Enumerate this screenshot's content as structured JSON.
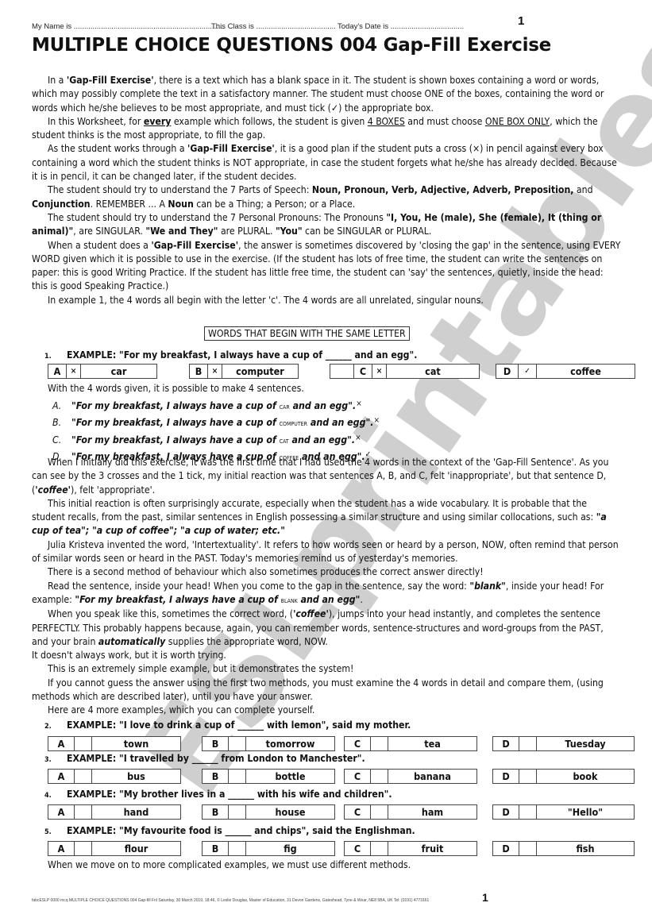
{
  "header": {
    "name_label": "My Name is ........................................................................",
    "class_label": "This Class is ......................................",
    "date_label": "Today's Date is ...................................",
    "page_number": "1"
  },
  "title": "MULTIPLE CHOICE QUESTIONS 004 Gap-Fill Exercise",
  "watermark": "ESLprintables.com",
  "intro": {
    "p1": {
      "a": "In a ",
      "b": "'Gap-Fill Exercise'",
      "c": ", there is a text which has a blank space in it. The student is shown boxes containing a word or words, which may possibly complete the text in a satisfactory manner. The student must choose ONE of the boxes, containing the word or words which he/she believes to be most appropriate, and must tick (✓) the appropriate box."
    },
    "p2": {
      "a": "In this Worksheet, for ",
      "b": "every",
      "c": " example which follows, the student is given ",
      "d": "4 BOXES",
      "e": " and must choose ",
      "f": "ONE BOX ONLY",
      "g": ", which the student thinks is the most appropriate, to fill the gap."
    },
    "p3": {
      "a": "As the student works through a ",
      "b": "'Gap-Fill Exercise'",
      "c": ", it is a good plan if the student puts a cross (×) in pencil against every box containing a word which the student thinks is NOT appropriate, in case the student forgets what he/she has already decided. Because it is in pencil, it can be changed later, if the student decides."
    },
    "p4": {
      "a": "The student should try to understand the 7 Parts of Speech: ",
      "b": "Noun, Pronoun, Verb, Adjective, Adverb, Preposition,",
      "c": " and ",
      "d": "Conjunction",
      "e": ". REMEMBER ... A ",
      "f": "Noun",
      "g": " can be a Thing; a Person; or a Place."
    },
    "p5": {
      "a": "The student should try to understand the 7 Personal Pronouns: The Pronouns ",
      "b": "\"I, You, He (male), She (female), It (thing or animal)\"",
      "c": ", are SINGULAR. ",
      "d": "\"We and They\"",
      "e": " are PLURAL. ",
      "f": "\"You\"",
      "g": " can be SINGULAR or PLURAL."
    },
    "p6": {
      "a": "When a student does a ",
      "b": "'Gap-Fill Exercise'",
      "c": ", the answer is sometimes discovered by 'closing the gap' in the sentence, using EVERY WORD given which it is possible to use in the exercise. (If the student has lots of free time, the student can write the sentences on paper: this is good Writing Practice. If the student has little free time, the student can 'say' the sentences, quietly, inside the head: this is good Speaking Practice.)"
    },
    "p7": "In example 1, the 4 words all begin with the letter 'c'. The 4 words are all unrelated, singular nouns."
  },
  "section_heading": "WORDS THAT BEGIN WITH THE SAME LETTER",
  "examples": [
    {
      "number": "1.",
      "question": "EXAMPLE: \"For my breakfast, I always have a cup of ______ and an egg\".",
      "options": [
        {
          "letter": "A",
          "mark": "×",
          "word": "car"
        },
        {
          "letter": "B",
          "mark": "×",
          "word": "computer"
        },
        {
          "letter": "C",
          "mark": "×",
          "word": "cat"
        },
        {
          "letter": "D",
          "mark": "✓",
          "word": "coffee"
        }
      ]
    },
    {
      "number": "2.",
      "question": "EXAMPLE: \"I love to drink a cup of ______ with lemon\", said my mother.",
      "options": [
        {
          "letter": "A",
          "mark": "",
          "word": "town"
        },
        {
          "letter": "B",
          "mark": "",
          "word": "tomorrow"
        },
        {
          "letter": "C",
          "mark": "",
          "word": "tea"
        },
        {
          "letter": "D",
          "mark": "",
          "word": "Tuesday"
        }
      ]
    },
    {
      "number": "3.",
      "question": "EXAMPLE: \"I travelled by ______ from London to Manchester\".",
      "options": [
        {
          "letter": "A",
          "mark": "",
          "word": "bus"
        },
        {
          "letter": "B",
          "mark": "",
          "word": "bottle"
        },
        {
          "letter": "C",
          "mark": "",
          "word": "banana"
        },
        {
          "letter": "D",
          "mark": "",
          "word": "book"
        }
      ]
    },
    {
      "number": "4.",
      "question": "EXAMPLE: \"My brother lives in a ______ with his wife and children\".",
      "options": [
        {
          "letter": "A",
          "mark": "",
          "word": "hand"
        },
        {
          "letter": "B",
          "mark": "",
          "word": "house"
        },
        {
          "letter": "C",
          "mark": "",
          "word": "ham"
        },
        {
          "letter": "D",
          "mark": "",
          "word": "\"Hello\""
        }
      ]
    },
    {
      "number": "5.",
      "question": "EXAMPLE: \"My favourite food is ______ and chips\", said the Englishman.",
      "options": [
        {
          "letter": "A",
          "mark": "",
          "word": "flour"
        },
        {
          "letter": "B",
          "mark": "",
          "word": "fig"
        },
        {
          "letter": "C",
          "mark": "",
          "word": "fruit"
        },
        {
          "letter": "D",
          "mark": "",
          "word": "fish"
        }
      ]
    }
  ],
  "after_example1": "With the 4 words given, it is possible to make 4 sentences.",
  "sentences": [
    {
      "label": "A.",
      "pre": "\"For my breakfast, I always have a cup of ",
      "word": "car",
      "post": " and an egg\".",
      "mark": "×"
    },
    {
      "label": "B.",
      "pre": "\"For my breakfast, I always have a cup of ",
      "word": "computer",
      "post": " and an egg\".",
      "mark": "×"
    },
    {
      "label": "C.",
      "pre": "\"For my breakfast, I always have a cup of ",
      "word": "cat",
      "post": " and an egg\".",
      "mark": "×"
    },
    {
      "label": "D.",
      "pre": "\"For my breakfast, I always have a cup of ",
      "word": "coffee",
      "post": " and an egg\".",
      "mark": "✓"
    }
  ],
  "body": {
    "q1": {
      "a": "When I initially did this exercise, it was the first time that I had used the 4 words in the context of the 'Gap-Fill Sentence'. As you can see by the 3 crosses and the 1 tick, my initial reaction was that sentences A, B, and C, felt 'inappropriate', but that sentence D, (",
      "b": "'coffee'",
      "c": "), felt 'appropriate'."
    },
    "q2": {
      "a": "This initial reaction is often surprisingly accurate, especially when the student has a wide vocabulary. It is probable that the student recalls, from the past, similar sentences in English possessing a similar structure and using similar collocations, such as: ",
      "b": "\"a cup of tea\"; \"a cup of coffee\"; \"a cup of water; etc.\""
    },
    "q3": "Julia Kristeva invented the word, 'Intertextuality'. It refers to how words seen or heard by a person, NOW, often remind that person of similar words seen or heard in the PAST. Today's memories remind us of yesterday's memories.",
    "q4": "There is a second method of behaviour which also sometimes produces the correct answer directly!",
    "q5": {
      "a": "Read the sentence, inside your head! When you come to the gap in the sentence, say the word: ",
      "b": "\"blank\"",
      "c": ", inside your head! For example: ",
      "d": "\"For my breakfast, I always have a cup of ",
      "e": "blank",
      "f": " and an egg\"",
      "g": "."
    },
    "q6": {
      "a": "When you speak like this, sometimes the correct word, (",
      "b": "'coffee'",
      "c": "), jumps into your head instantly, and completes the sentence PERFECTLY. This probably happens because, again, you can remember words, sentence-structures and word-groups from the PAST, and your brain ",
      "d": "automatically",
      "e": " supplies the appropriate word, NOW."
    },
    "q7": "It doesn't always work, but it is worth trying.",
    "q8": "This is an extremely simple example, but it demonstrates the system!",
    "q9": "If you cannot guess the answer using the first two methods, you must examine the 4 words in detail and compare them, (using methods which are described later), until you have your answer.",
    "q10": "Here are 4 more examples, which you can complete yourself."
  },
  "closing": "When we move on to more complicated examples, we must use different methods.",
  "footer": {
    "text": "fabcESLP 0000 mcq MULTIPLE CHOICE QUESTIONS 004 Gap-fill Fnl  Saturday, 30 March 2019, 18:46, © Leslie Douglas, Master of Education, 31 Devon Gardens, Gateshead, Tyne & Wear, NE8 5BA, UK Tel: (0191) 4773161",
    "page_number": "1"
  }
}
